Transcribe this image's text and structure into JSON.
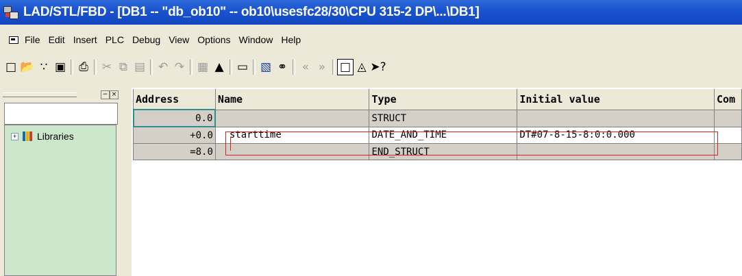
{
  "window": {
    "title": "LAD/STL/FBD  - [DB1 -- \"db_ob10\" -- ob10\\usesfc28/30\\CPU 315-2 DP\\...\\DB1]"
  },
  "menu": {
    "items": [
      "File",
      "Edit",
      "Insert",
      "PLC",
      "Debug",
      "View",
      "Options",
      "Window",
      "Help"
    ]
  },
  "toolbar": {
    "icons": [
      "new-icon",
      "open-icon",
      "accessible-nodes-icon",
      "save-icon",
      "print-icon",
      "cut-icon",
      "copy-icon",
      "paste-icon",
      "undo-icon",
      "redo-icon",
      "download-icon",
      "upload-icon",
      "monitor-icon",
      "declaration-view-icon",
      "data-view-icon",
      "prev-icon",
      "next-icon",
      "overview-icon",
      "detail-view-icon",
      "help-icon"
    ]
  },
  "sidebar": {
    "tree": [
      {
        "label": "Libraries"
      }
    ]
  },
  "table": {
    "columns": [
      "Address",
      "Name",
      "Type",
      "Initial value",
      "Com"
    ],
    "rows": [
      {
        "address": "0.0",
        "name": "",
        "type": "STRUCT",
        "initial": "",
        "comment": ""
      },
      {
        "address": "+0.0",
        "name": "starttime",
        "type": "DATE_AND_TIME",
        "initial": "DT#07-8-15-8:0:0.000",
        "comment": ""
      },
      {
        "address": "=8.0",
        "name": "",
        "type": "END_STRUCT",
        "initial": "",
        "comment": ""
      }
    ]
  }
}
